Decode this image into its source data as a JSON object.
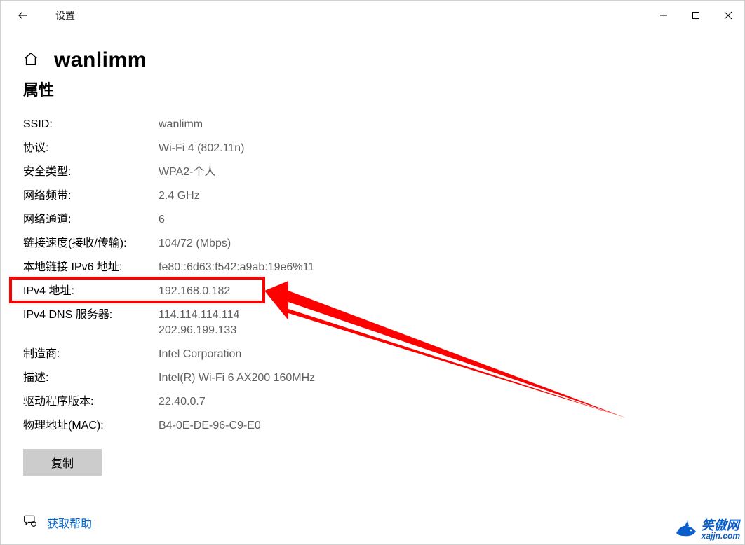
{
  "window": {
    "title": "设置"
  },
  "header": {
    "page_title": "wanlimm",
    "section_title": "属性"
  },
  "properties": {
    "ssid": {
      "label": "SSID:",
      "value": "wanlimm"
    },
    "protocol": {
      "label": "协议:",
      "value": "Wi-Fi 4 (802.11n)"
    },
    "security_type": {
      "label": "安全类型:",
      "value": "WPA2-个人"
    },
    "band": {
      "label": "网络频带:",
      "value": "2.4 GHz"
    },
    "channel": {
      "label": "网络通道:",
      "value": "6"
    },
    "link_speed": {
      "label": "链接速度(接收/传输):",
      "value": "104/72 (Mbps)"
    },
    "ipv6_local": {
      "label": "本地链接 IPv6 地址:",
      "value": "fe80::6d63:f542:a9ab:19e6%11"
    },
    "ipv4": {
      "label": "IPv4 地址:",
      "value": "192.168.0.182"
    },
    "ipv4_dns": {
      "label": "IPv4 DNS 服务器:",
      "value": "114.114.114.114\n202.96.199.133"
    },
    "manufacturer": {
      "label": "制造商:",
      "value": "Intel Corporation"
    },
    "description": {
      "label": "描述:",
      "value": "Intel(R) Wi-Fi 6 AX200 160MHz"
    },
    "driver_version": {
      "label": "驱动程序版本:",
      "value": "22.40.0.7"
    },
    "mac": {
      "label": "物理地址(MAC):",
      "value": "B4-0E-DE-96-C9-E0"
    }
  },
  "buttons": {
    "copy": "复制"
  },
  "help": {
    "link_text": "获取帮助"
  },
  "watermark": {
    "cn": "笑傲网",
    "url": "xajjn.com"
  }
}
